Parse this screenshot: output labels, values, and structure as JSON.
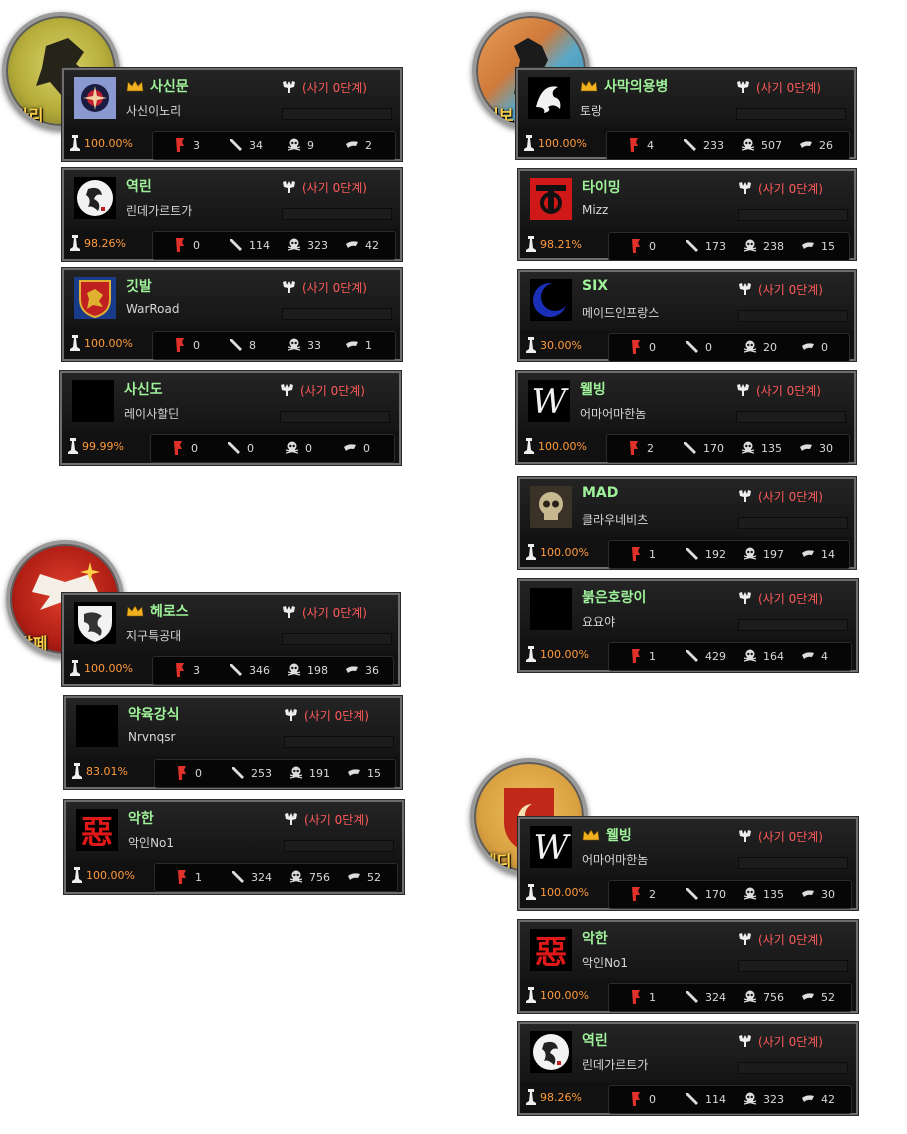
{
  "colors": {
    "name": "#9ff29a",
    "morale": "#ff5a5a",
    "percent": "#ff9a3c",
    "crown": "#f0b020"
  },
  "groups": [
    {
      "caption": "바리",
      "emblem_icon": "wolf-emblem-icon",
      "cards": [
        {
          "icon": "emperor-crest-icon",
          "crown": true,
          "name": "사신문",
          "sub": "사신이노리",
          "morale": "(사기 0단계)",
          "percent": "100.00%",
          "s1": "3",
          "s2": "34",
          "s3": "9",
          "s4": "2"
        },
        {
          "icon": "dragon-moon-icon",
          "crown": false,
          "name": "역린",
          "sub": "린데가르트가",
          "morale": "(사기 0단계)",
          "percent": "98.26%",
          "s1": "0",
          "s2": "114",
          "s3": "323",
          "s4": "42"
        },
        {
          "icon": "lion-shield-icon",
          "crown": false,
          "name": "깃발",
          "sub": "WarRoad",
          "morale": "(사기 0단계)",
          "percent": "100.00%",
          "s1": "0",
          "s2": "8",
          "s3": "33",
          "s4": "1"
        },
        {
          "icon": "blank-icon",
          "crown": false,
          "name": "사신도",
          "sub": "레이사할딘",
          "morale": "(사기 0단계)",
          "percent": "99.99%",
          "s1": "0",
          "s2": "0",
          "s3": "0",
          "s4": "0"
        }
      ]
    },
    {
      "caption": "서보",
      "emblem_icon": "horse-emblem-icon",
      "cards": [
        {
          "icon": "white-dragon-icon",
          "crown": true,
          "name": "사막의용병",
          "sub": "토랑",
          "morale": "(사기 0단계)",
          "percent": "100.00%",
          "s1": "4",
          "s2": "233",
          "s3": "507",
          "s4": "26"
        },
        {
          "icon": "red-symbol-icon",
          "crown": false,
          "name": "타이밍",
          "sub": "Mizz",
          "morale": "(사기 0단계)",
          "percent": "98.21%",
          "s1": "0",
          "s2": "173",
          "s3": "238",
          "s4": "15"
        },
        {
          "icon": "blue-crescent-icon",
          "crown": false,
          "name": "SIX",
          "sub": "메이드인프랑스",
          "morale": "(사기 0단계)",
          "percent": "30.00%",
          "s1": "0",
          "s2": "0",
          "s3": "20",
          "s4": "0"
        },
        {
          "icon": "w-script-icon",
          "crown": false,
          "name": "웰빙",
          "sub": "어마어마한놈",
          "morale": "(사기 0단계)",
          "percent": "100.00%",
          "s1": "2",
          "s2": "170",
          "s3": "135",
          "s4": "30"
        },
        {
          "icon": "skull-icon",
          "crown": false,
          "name": "MAD",
          "sub": "클라우네비츠",
          "morale": "(사기 0단계)",
          "percent": "100.00%",
          "s1": "1",
          "s2": "192",
          "s3": "197",
          "s4": "14"
        },
        {
          "icon": "blank-icon",
          "crown": false,
          "name": "붉은호랑이",
          "sub": "요요야",
          "morale": "(사기 0단계)",
          "percent": "100.00%",
          "s1": "1",
          "s2": "429",
          "s3": "164",
          "s4": "4"
        }
      ]
    },
    {
      "caption": "칼페",
      "emblem_icon": "eagle-emblem-icon",
      "cards": [
        {
          "icon": "dragon-shield-icon",
          "crown": true,
          "name": "헤로스",
          "sub": "지구특공대",
          "morale": "(사기 0단계)",
          "percent": "100.00%",
          "s1": "3",
          "s2": "346",
          "s3": "198",
          "s4": "36"
        },
        {
          "icon": "blank-icon",
          "crown": false,
          "name": "약육강식",
          "sub": "Nrvnqsr",
          "morale": "(사기 0단계)",
          "percent": "83.01%",
          "s1": "0",
          "s2": "253",
          "s3": "191",
          "s4": "15"
        },
        {
          "icon": "red-kanji-icon",
          "crown": false,
          "glyph": "惡",
          "name": "악한",
          "sub": "악인No1",
          "morale": "(사기 0단계)",
          "percent": "100.00%",
          "s1": "1",
          "s2": "324",
          "s3": "756",
          "s4": "52"
        }
      ]
    },
    {
      "caption": "메디",
      "emblem_icon": "crescent-shield-emblem-icon",
      "cards": [
        {
          "icon": "w-script-icon",
          "crown": true,
          "name": "웰빙",
          "sub": "어마어마한놈",
          "morale": "(사기 0단계)",
          "percent": "100.00%",
          "s1": "2",
          "s2": "170",
          "s3": "135",
          "s4": "30"
        },
        {
          "icon": "red-kanji-icon",
          "crown": false,
          "glyph": "惡",
          "name": "악한",
          "sub": "악인No1",
          "morale": "(사기 0단계)",
          "percent": "100.00%",
          "s1": "1",
          "s2": "324",
          "s3": "756",
          "s4": "52"
        },
        {
          "icon": "dragon-moon-icon",
          "crown": false,
          "name": "역린",
          "sub": "린데가르트가",
          "morale": "(사기 0단계)",
          "percent": "98.26%",
          "s1": "0",
          "s2": "114",
          "s3": "323",
          "s4": "42"
        }
      ]
    }
  ]
}
